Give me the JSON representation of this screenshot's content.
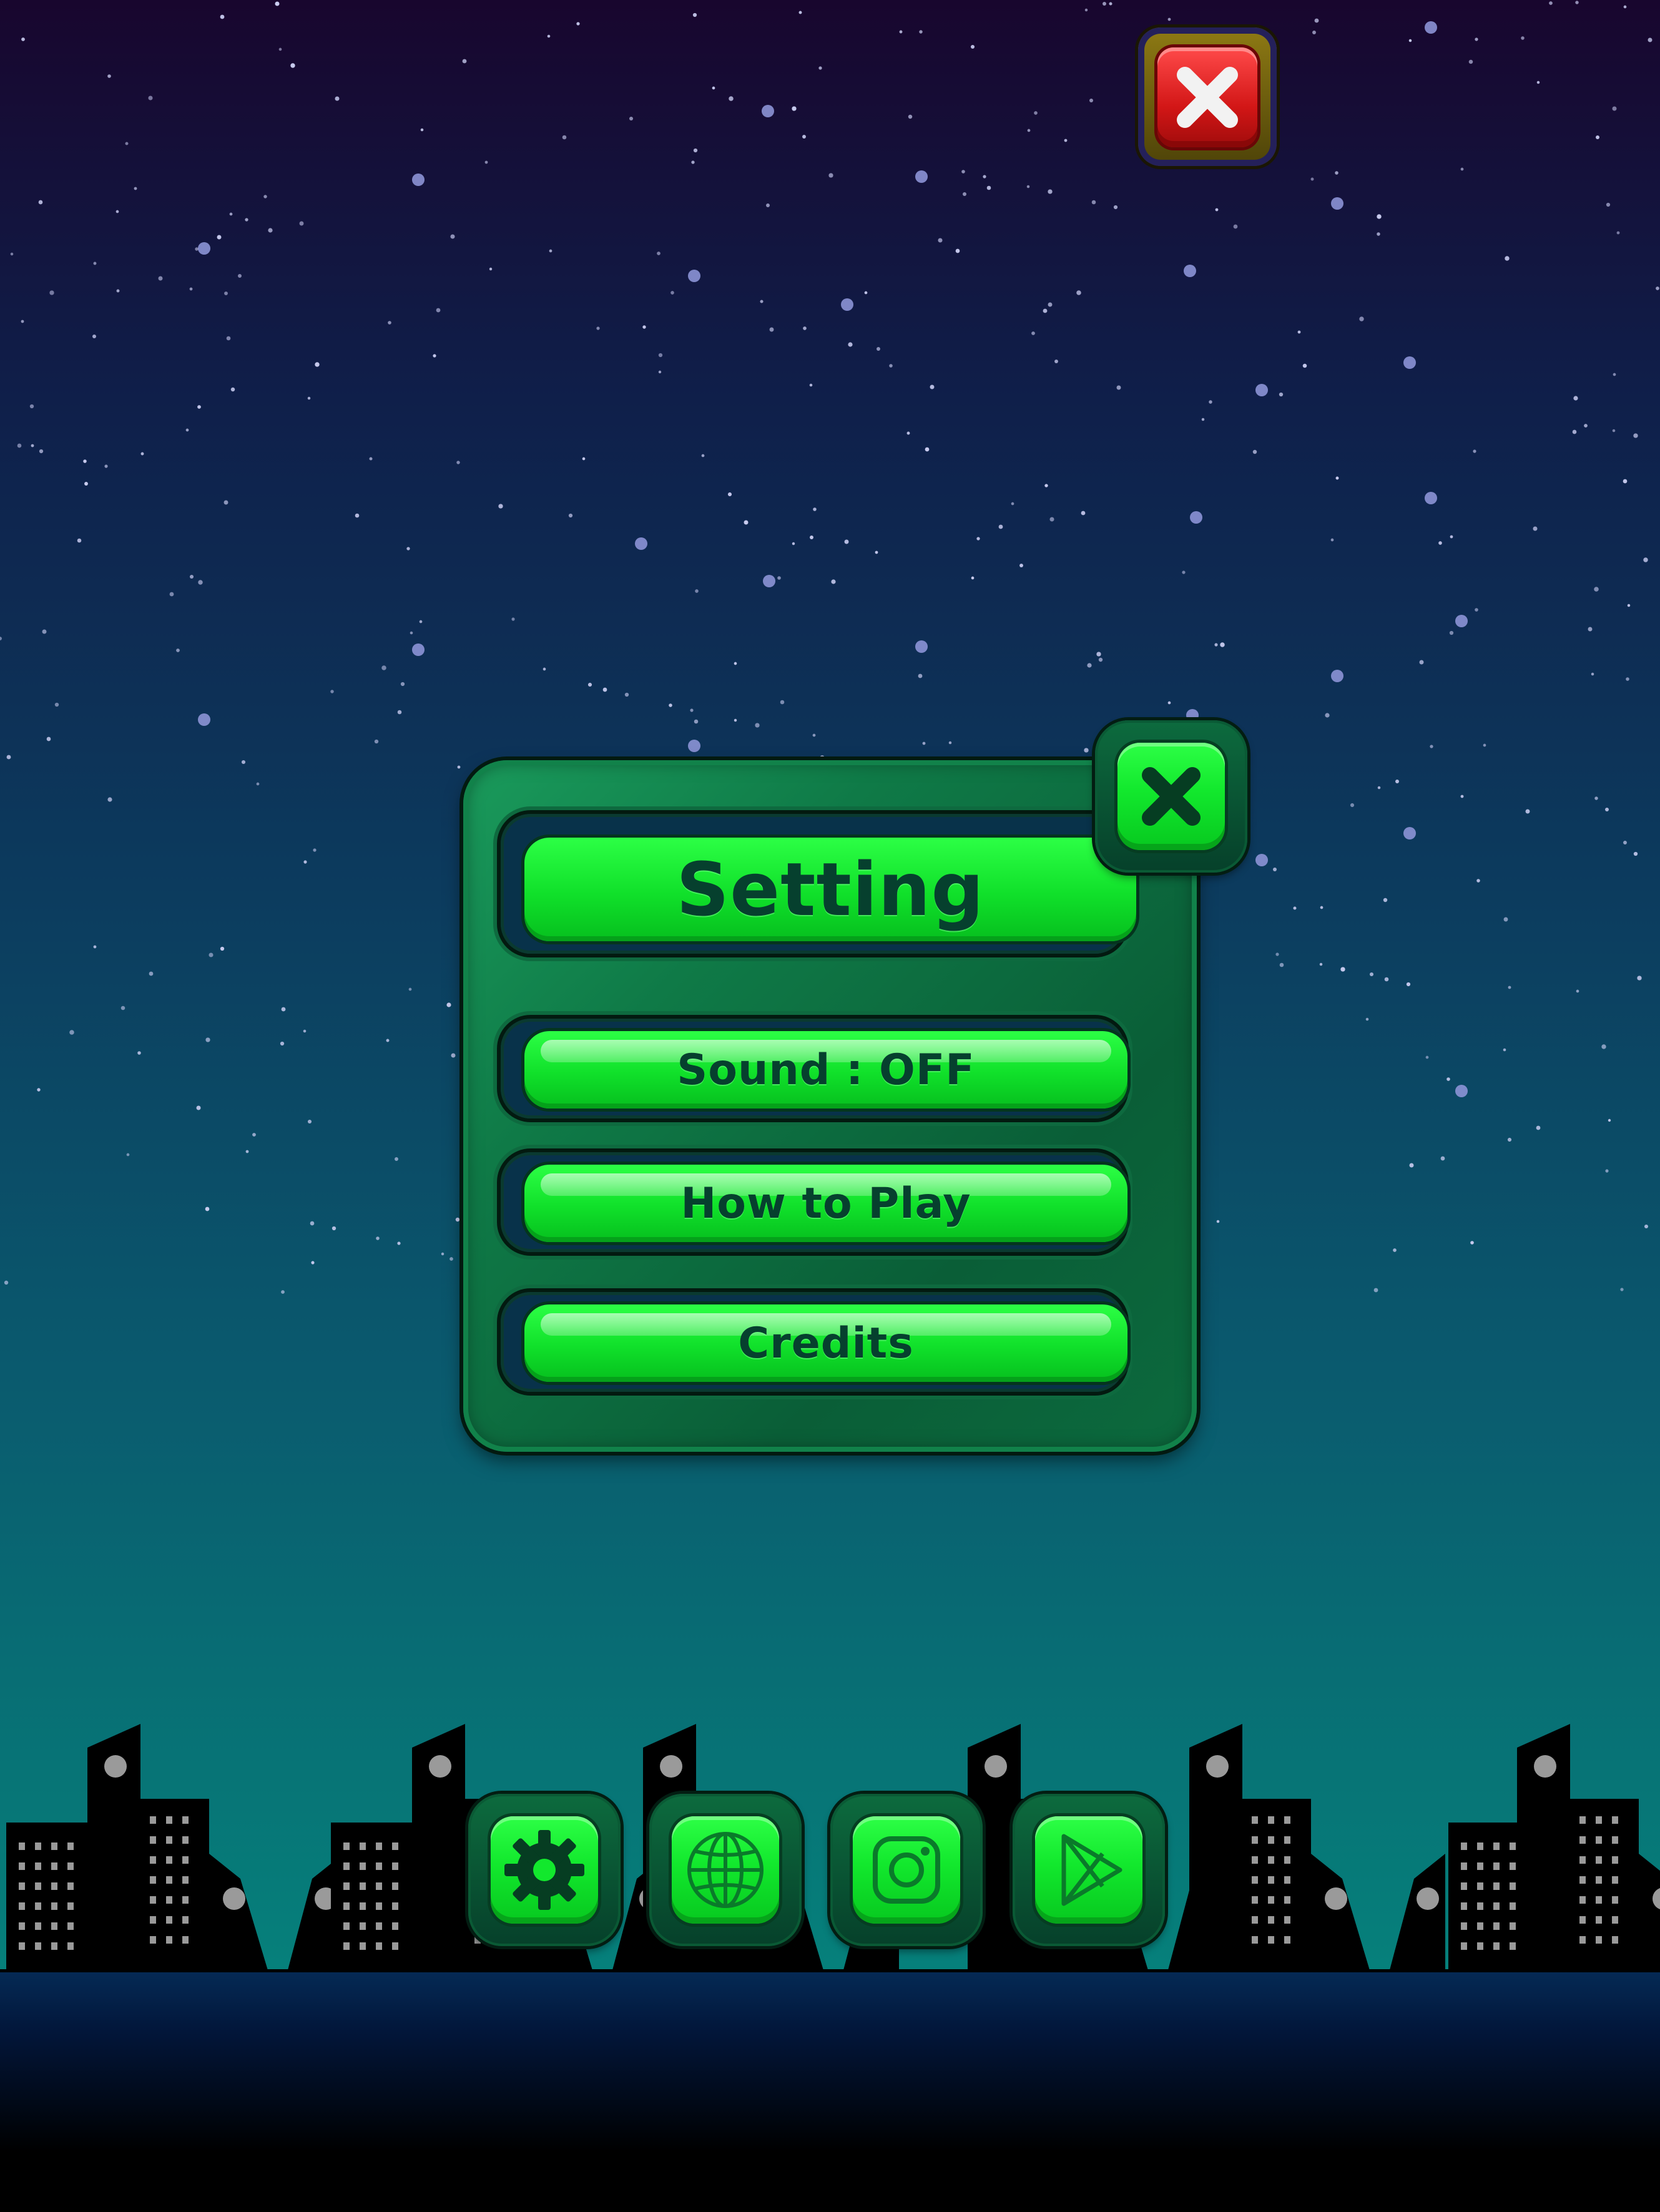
{
  "screen": "settings",
  "colors": {
    "accent": "#12e82d",
    "panel": "#0f7a47",
    "text_dark": "#06402e",
    "close_red": "#d21616",
    "close_red_frame": "#8e7a14",
    "star": "#8c93d6",
    "building": "#000000",
    "building_window": "#9a9a9a"
  },
  "panel": {
    "title": "Setting",
    "items": [
      {
        "label": "Sound : OFF"
      },
      {
        "label": "How to Play"
      },
      {
        "label": "Credits"
      }
    ]
  },
  "icons": {
    "top_close": "close-icon-red",
    "panel_close": "close-icon-green",
    "bottom_bar": [
      "gear-icon",
      "globe-icon",
      "instagram-icon",
      "play-store-icon"
    ]
  }
}
